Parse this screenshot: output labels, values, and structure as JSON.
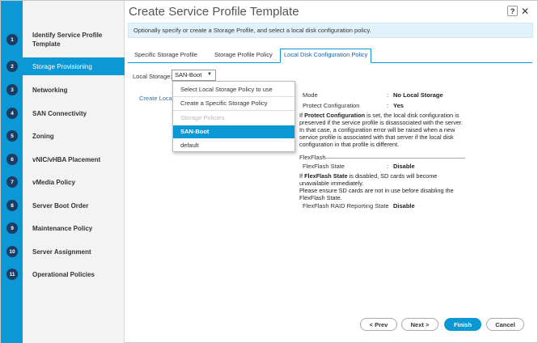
{
  "title": "Create Service Profile Template",
  "header": {
    "help_label": "?",
    "close_label": "✕"
  },
  "description": "Optionally specify or create a Storage Profile, and select a local disk configuration policy.",
  "steps": [
    {
      "num": "1",
      "label": "Identify Service Profile Template"
    },
    {
      "num": "2",
      "label": "Storage Provisioning"
    },
    {
      "num": "3",
      "label": "Networking"
    },
    {
      "num": "4",
      "label": "SAN Connectivity"
    },
    {
      "num": "5",
      "label": "Zoning"
    },
    {
      "num": "6",
      "label": "vNIC/vHBA Placement"
    },
    {
      "num": "7",
      "label": "vMedia Policy"
    },
    {
      "num": "8",
      "label": "Server Boot Order"
    },
    {
      "num": "9",
      "label": "Maintenance Policy"
    },
    {
      "num": "10",
      "label": "Server Assignment"
    },
    {
      "num": "11",
      "label": "Operational Policies"
    }
  ],
  "active_step": "2",
  "tabs": [
    {
      "label": "Specific Storage Profile"
    },
    {
      "label": "Storage Profile Policy"
    },
    {
      "label": "Local Disk Configuration Policy"
    }
  ],
  "local_storage": {
    "label": "Local Storage:",
    "value": "SAN-Boot",
    "caret": "▼",
    "create_link": "Create Loca"
  },
  "dropdown": {
    "items": [
      {
        "label": "Select Local Storage Policy to use"
      },
      {
        "label": "Create a Specific Storage Policy"
      },
      {
        "label": "Storage Policies"
      },
      {
        "label": "SAN-Boot"
      },
      {
        "label": "default"
      }
    ]
  },
  "details": {
    "mode_label": "Mode",
    "mode_sep": ":",
    "mode_value": "No Local Storage",
    "protect_label": "Protect Configuration",
    "protect_sep": ":",
    "protect_value": "Yes",
    "protect_note_prefix": "If ",
    "protect_note_bold": "Protect Configuration",
    "protect_note_rest": " is set, the local disk configuration is preserved if the service profile is disassociated with the server. In that case, a configuration error will be raised when a new service profile is associated with that server if the local disk configuration in that profile is different.",
    "flexflash_heading": "FlexFlash",
    "flexflash_state_label": "FlexFlash State",
    "flexflash_state_sep": ":",
    "flexflash_state_value": "Disable",
    "flexflash_note_prefix": "If ",
    "flexflash_note_bold": "FlexFlash State",
    "flexflash_note_rest": " is disabled, SD cards will become unavailable immediately.",
    "flexflash_note_2": "Please ensure SD cards are not in use before disabling the FlexFlash State.",
    "raid_label": "FlexFlash RAID Reporting State",
    "raid_sep": ":",
    "raid_value": "Disable"
  },
  "buttons": {
    "prev": "< Prev",
    "next": "Next >",
    "finish": "Finish",
    "cancel": "Cancel"
  },
  "colors": {
    "accent": "#0b98d4",
    "step_badge": "#1b3d63",
    "link": "#2d73b9"
  }
}
